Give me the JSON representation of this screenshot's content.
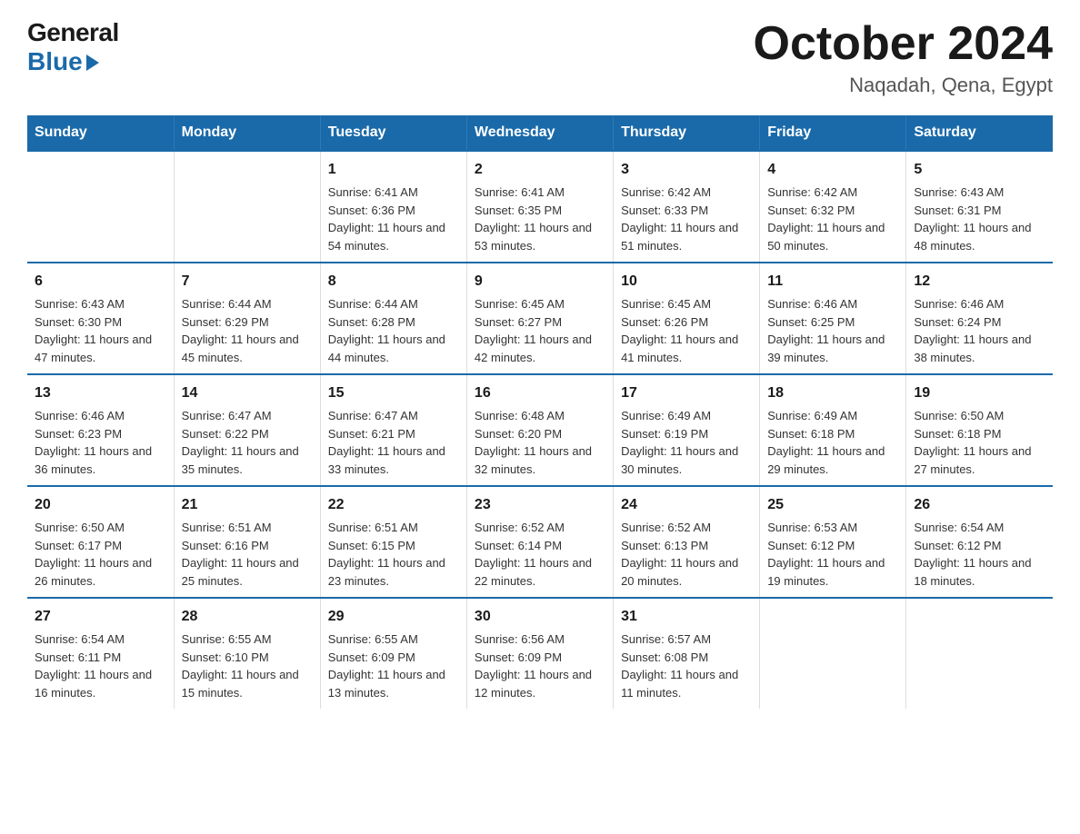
{
  "logo": {
    "general": "General",
    "blue": "Blue"
  },
  "title": {
    "month_year": "October 2024",
    "location": "Naqadah, Qena, Egypt"
  },
  "days_of_week": [
    "Sunday",
    "Monday",
    "Tuesday",
    "Wednesday",
    "Thursday",
    "Friday",
    "Saturday"
  ],
  "weeks": [
    [
      {
        "day": "",
        "sunrise": "",
        "sunset": "",
        "daylight": ""
      },
      {
        "day": "",
        "sunrise": "",
        "sunset": "",
        "daylight": ""
      },
      {
        "day": "1",
        "sunrise": "Sunrise: 6:41 AM",
        "sunset": "Sunset: 6:36 PM",
        "daylight": "Daylight: 11 hours and 54 minutes."
      },
      {
        "day": "2",
        "sunrise": "Sunrise: 6:41 AM",
        "sunset": "Sunset: 6:35 PM",
        "daylight": "Daylight: 11 hours and 53 minutes."
      },
      {
        "day": "3",
        "sunrise": "Sunrise: 6:42 AM",
        "sunset": "Sunset: 6:33 PM",
        "daylight": "Daylight: 11 hours and 51 minutes."
      },
      {
        "day": "4",
        "sunrise": "Sunrise: 6:42 AM",
        "sunset": "Sunset: 6:32 PM",
        "daylight": "Daylight: 11 hours and 50 minutes."
      },
      {
        "day": "5",
        "sunrise": "Sunrise: 6:43 AM",
        "sunset": "Sunset: 6:31 PM",
        "daylight": "Daylight: 11 hours and 48 minutes."
      }
    ],
    [
      {
        "day": "6",
        "sunrise": "Sunrise: 6:43 AM",
        "sunset": "Sunset: 6:30 PM",
        "daylight": "Daylight: 11 hours and 47 minutes."
      },
      {
        "day": "7",
        "sunrise": "Sunrise: 6:44 AM",
        "sunset": "Sunset: 6:29 PM",
        "daylight": "Daylight: 11 hours and 45 minutes."
      },
      {
        "day": "8",
        "sunrise": "Sunrise: 6:44 AM",
        "sunset": "Sunset: 6:28 PM",
        "daylight": "Daylight: 11 hours and 44 minutes."
      },
      {
        "day": "9",
        "sunrise": "Sunrise: 6:45 AM",
        "sunset": "Sunset: 6:27 PM",
        "daylight": "Daylight: 11 hours and 42 minutes."
      },
      {
        "day": "10",
        "sunrise": "Sunrise: 6:45 AM",
        "sunset": "Sunset: 6:26 PM",
        "daylight": "Daylight: 11 hours and 41 minutes."
      },
      {
        "day": "11",
        "sunrise": "Sunrise: 6:46 AM",
        "sunset": "Sunset: 6:25 PM",
        "daylight": "Daylight: 11 hours and 39 minutes."
      },
      {
        "day": "12",
        "sunrise": "Sunrise: 6:46 AM",
        "sunset": "Sunset: 6:24 PM",
        "daylight": "Daylight: 11 hours and 38 minutes."
      }
    ],
    [
      {
        "day": "13",
        "sunrise": "Sunrise: 6:46 AM",
        "sunset": "Sunset: 6:23 PM",
        "daylight": "Daylight: 11 hours and 36 minutes."
      },
      {
        "day": "14",
        "sunrise": "Sunrise: 6:47 AM",
        "sunset": "Sunset: 6:22 PM",
        "daylight": "Daylight: 11 hours and 35 minutes."
      },
      {
        "day": "15",
        "sunrise": "Sunrise: 6:47 AM",
        "sunset": "Sunset: 6:21 PM",
        "daylight": "Daylight: 11 hours and 33 minutes."
      },
      {
        "day": "16",
        "sunrise": "Sunrise: 6:48 AM",
        "sunset": "Sunset: 6:20 PM",
        "daylight": "Daylight: 11 hours and 32 minutes."
      },
      {
        "day": "17",
        "sunrise": "Sunrise: 6:49 AM",
        "sunset": "Sunset: 6:19 PM",
        "daylight": "Daylight: 11 hours and 30 minutes."
      },
      {
        "day": "18",
        "sunrise": "Sunrise: 6:49 AM",
        "sunset": "Sunset: 6:18 PM",
        "daylight": "Daylight: 11 hours and 29 minutes."
      },
      {
        "day": "19",
        "sunrise": "Sunrise: 6:50 AM",
        "sunset": "Sunset: 6:18 PM",
        "daylight": "Daylight: 11 hours and 27 minutes."
      }
    ],
    [
      {
        "day": "20",
        "sunrise": "Sunrise: 6:50 AM",
        "sunset": "Sunset: 6:17 PM",
        "daylight": "Daylight: 11 hours and 26 minutes."
      },
      {
        "day": "21",
        "sunrise": "Sunrise: 6:51 AM",
        "sunset": "Sunset: 6:16 PM",
        "daylight": "Daylight: 11 hours and 25 minutes."
      },
      {
        "day": "22",
        "sunrise": "Sunrise: 6:51 AM",
        "sunset": "Sunset: 6:15 PM",
        "daylight": "Daylight: 11 hours and 23 minutes."
      },
      {
        "day": "23",
        "sunrise": "Sunrise: 6:52 AM",
        "sunset": "Sunset: 6:14 PM",
        "daylight": "Daylight: 11 hours and 22 minutes."
      },
      {
        "day": "24",
        "sunrise": "Sunrise: 6:52 AM",
        "sunset": "Sunset: 6:13 PM",
        "daylight": "Daylight: 11 hours and 20 minutes."
      },
      {
        "day": "25",
        "sunrise": "Sunrise: 6:53 AM",
        "sunset": "Sunset: 6:12 PM",
        "daylight": "Daylight: 11 hours and 19 minutes."
      },
      {
        "day": "26",
        "sunrise": "Sunrise: 6:54 AM",
        "sunset": "Sunset: 6:12 PM",
        "daylight": "Daylight: 11 hours and 18 minutes."
      }
    ],
    [
      {
        "day": "27",
        "sunrise": "Sunrise: 6:54 AM",
        "sunset": "Sunset: 6:11 PM",
        "daylight": "Daylight: 11 hours and 16 minutes."
      },
      {
        "day": "28",
        "sunrise": "Sunrise: 6:55 AM",
        "sunset": "Sunset: 6:10 PM",
        "daylight": "Daylight: 11 hours and 15 minutes."
      },
      {
        "day": "29",
        "sunrise": "Sunrise: 6:55 AM",
        "sunset": "Sunset: 6:09 PM",
        "daylight": "Daylight: 11 hours and 13 minutes."
      },
      {
        "day": "30",
        "sunrise": "Sunrise: 6:56 AM",
        "sunset": "Sunset: 6:09 PM",
        "daylight": "Daylight: 11 hours and 12 minutes."
      },
      {
        "day": "31",
        "sunrise": "Sunrise: 6:57 AM",
        "sunset": "Sunset: 6:08 PM",
        "daylight": "Daylight: 11 hours and 11 minutes."
      },
      {
        "day": "",
        "sunrise": "",
        "sunset": "",
        "daylight": ""
      },
      {
        "day": "",
        "sunrise": "",
        "sunset": "",
        "daylight": ""
      }
    ]
  ]
}
